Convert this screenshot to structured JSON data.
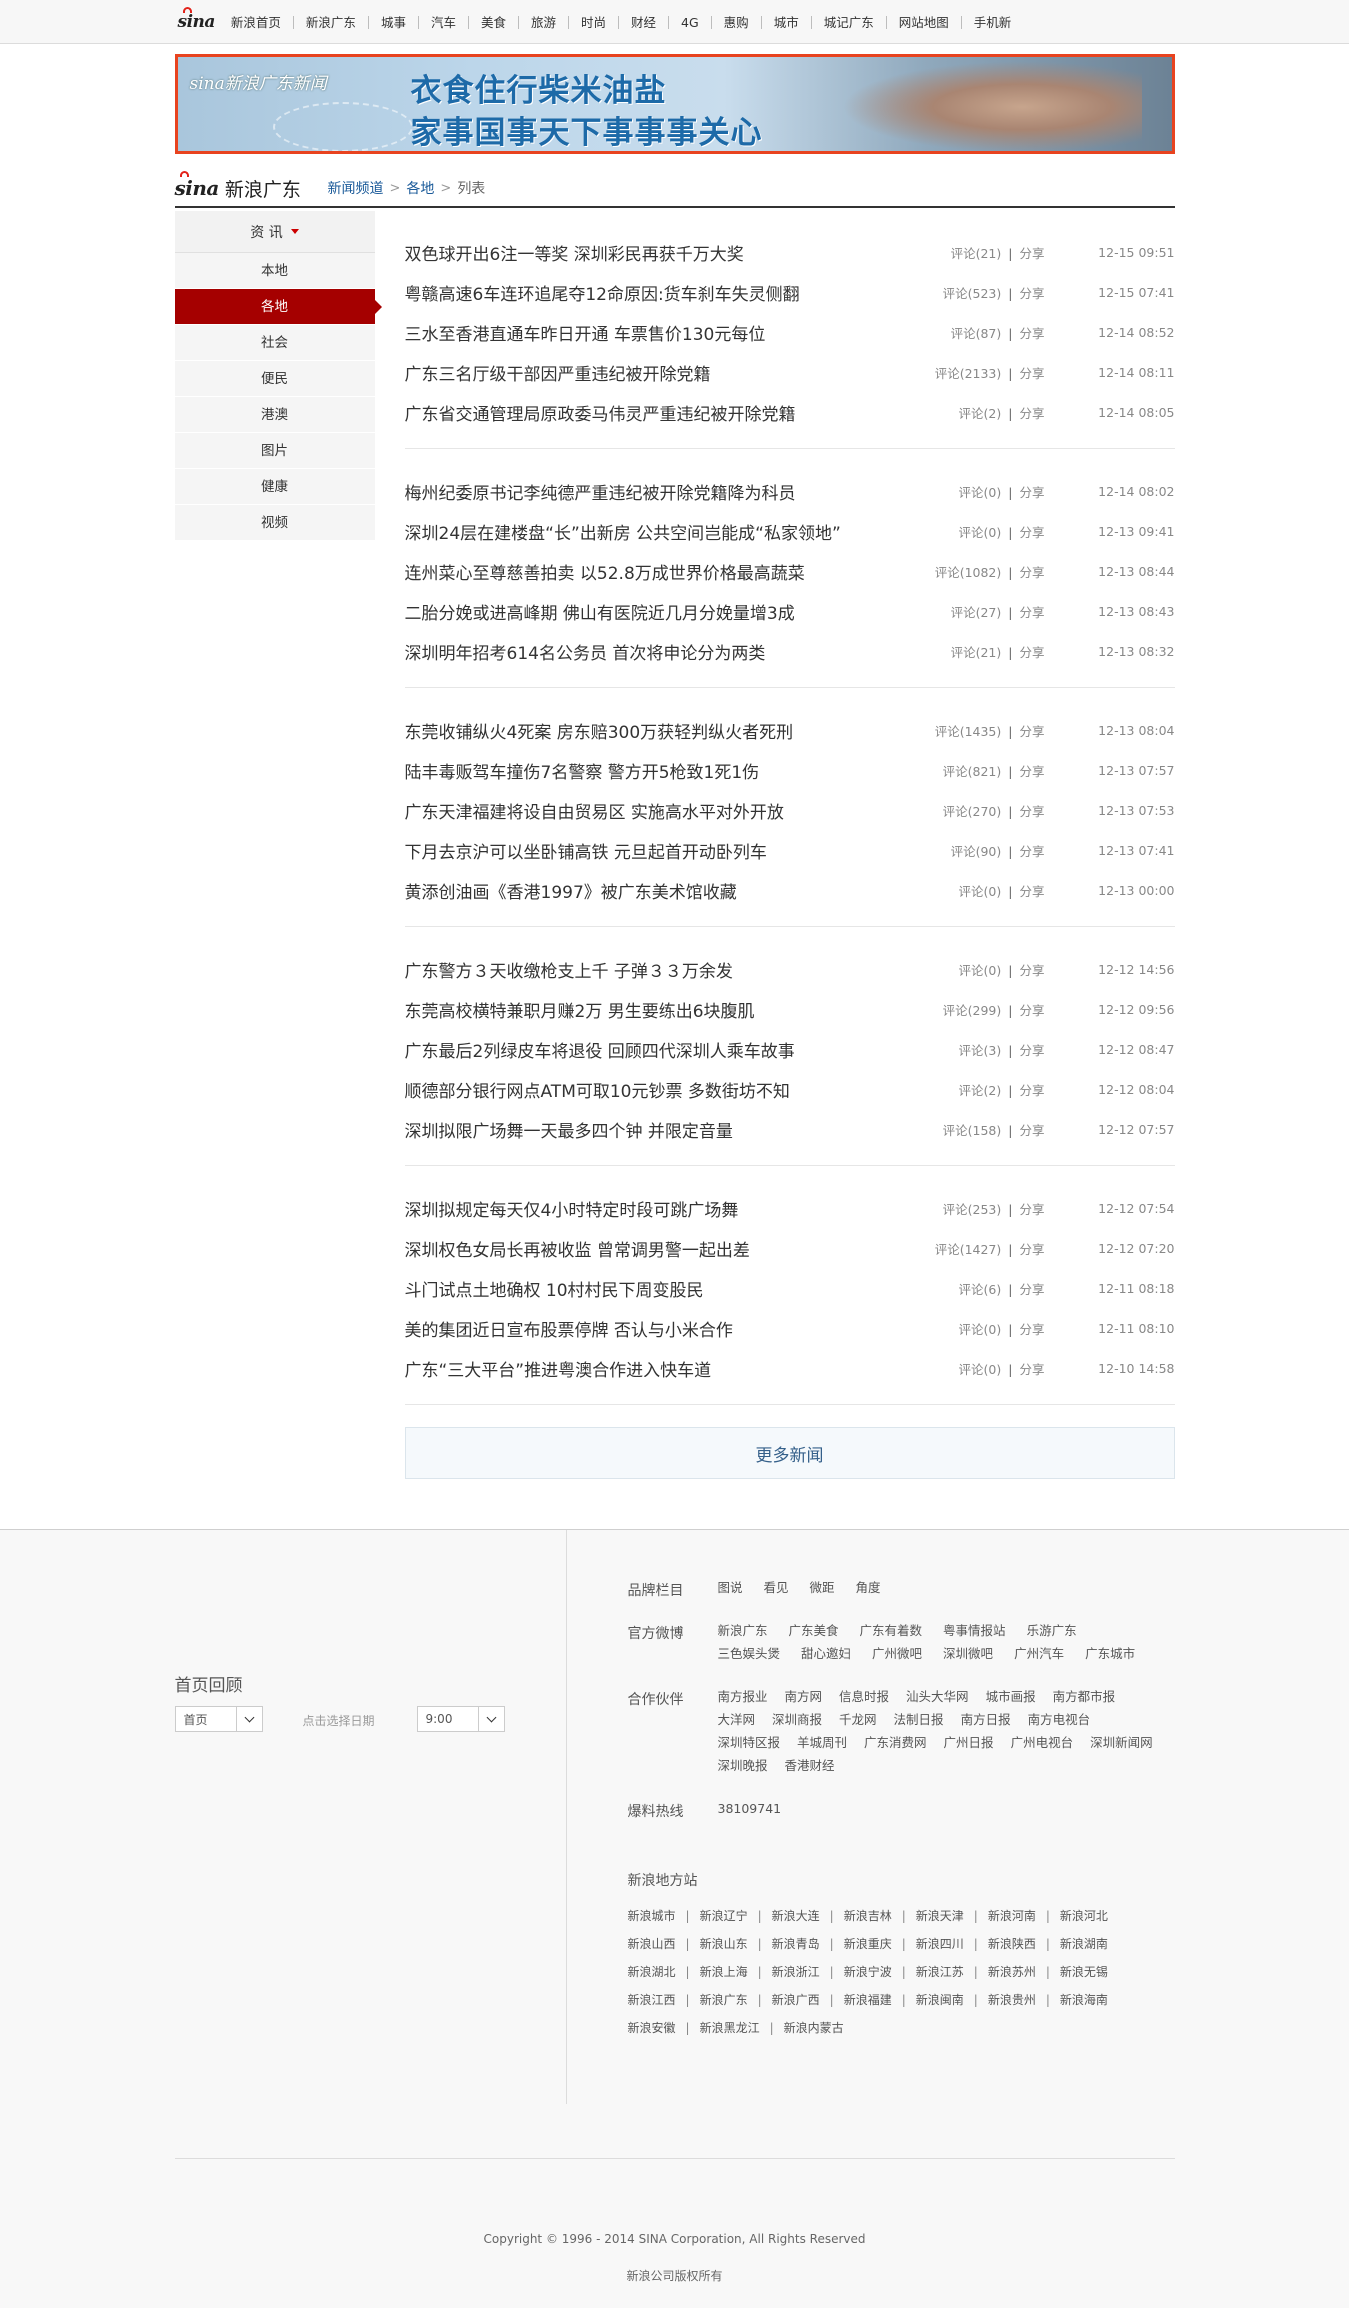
{
  "topnav": {
    "logo": "sina",
    "items": [
      "新浪首页",
      "新浪广东",
      "城事",
      "汽车",
      "美食",
      "旅游",
      "时尚",
      "财经",
      "4G",
      "惠购",
      "城市",
      "城记广东",
      "网站地图",
      "手机新"
    ]
  },
  "banner": {
    "brand": "sina新浪广东新闻",
    "line1": "衣食住行柴米油盐",
    "line2": "家事国事天下事事事关心"
  },
  "header": {
    "logo_text": "新浪广东",
    "breadcrumb": [
      "新闻频道",
      "各地",
      "列表"
    ],
    "breadcrumb_sep": ">"
  },
  "sidebar": {
    "head": "资 讯",
    "items": [
      "本地",
      "各地",
      "社会",
      "便民",
      "港澳",
      "图片",
      "健康",
      "视频"
    ],
    "active_index": 1
  },
  "news": {
    "groups": [
      [
        {
          "title": "双色球开出6注一等奖 深圳彩民再获千万大奖",
          "comments": "评论(21)",
          "share": "分享",
          "time": "12-15 09:51"
        },
        {
          "title": "粤赣高速6车连环追尾夺12命原因:货车刹车失灵侧翻",
          "comments": "评论(523)",
          "share": "分享",
          "time": "12-15 07:41"
        },
        {
          "title": "三水至香港直通车昨日开通 车票售价130元每位",
          "comments": "评论(87)",
          "share": "分享",
          "time": "12-14 08:52"
        },
        {
          "title": "广东三名厅级干部因严重违纪被开除党籍",
          "comments": "评论(2133)",
          "share": "分享",
          "time": "12-14 08:11"
        },
        {
          "title": "广东省交通管理局原政委马伟灵严重违纪被开除党籍",
          "comments": "评论(2)",
          "share": "分享",
          "time": "12-14 08:05"
        }
      ],
      [
        {
          "title": "梅州纪委原书记李纯德严重违纪被开除党籍降为科员",
          "comments": "评论(0)",
          "share": "分享",
          "time": "12-14 08:02"
        },
        {
          "title": "深圳24层在建楼盘“长”出新房 公共空间岂能成“私家领地”",
          "comments": "评论(0)",
          "share": "分享",
          "time": "12-13 09:41"
        },
        {
          "title": "连州菜心至尊慈善拍卖 以52.8万成世界价格最高蔬菜",
          "comments": "评论(1082)",
          "share": "分享",
          "time": "12-13 08:44"
        },
        {
          "title": "二胎分娩或进高峰期 佛山有医院近几月分娩量增3成",
          "comments": "评论(27)",
          "share": "分享",
          "time": "12-13 08:43"
        },
        {
          "title": "深圳明年招考614名公务员 首次将申论分为两类",
          "comments": "评论(21)",
          "share": "分享",
          "time": "12-13 08:32"
        }
      ],
      [
        {
          "title": "东莞收铺纵火4死案 房东赔300万获轻判纵火者死刑",
          "comments": "评论(1435)",
          "share": "分享",
          "time": "12-13 08:04"
        },
        {
          "title": "陆丰毒贩驾车撞伤7名警察 警方开5枪致1死1伤",
          "comments": "评论(821)",
          "share": "分享",
          "time": "12-13 07:57"
        },
        {
          "title": "广东天津福建将设自由贸易区 实施高水平对外开放",
          "comments": "评论(270)",
          "share": "分享",
          "time": "12-13 07:53"
        },
        {
          "title": "下月去京沪可以坐卧铺高铁 元旦起首开动卧列车",
          "comments": "评论(90)",
          "share": "分享",
          "time": "12-13 07:41"
        },
        {
          "title": "黄添创油画《香港1997》被广东美术馆收藏",
          "comments": "评论(0)",
          "share": "分享",
          "time": "12-13 00:00"
        }
      ],
      [
        {
          "title": "广东警方３天收缴枪支上千 子弹３３万余发",
          "comments": "评论(0)",
          "share": "分享",
          "time": "12-12 14:56"
        },
        {
          "title": "东莞高校横特兼职月赚2万 男生要练出6块腹肌",
          "comments": "评论(299)",
          "share": "分享",
          "time": "12-12 09:56"
        },
        {
          "title": "广东最后2列绿皮车将退役 回顾四代深圳人乘车故事",
          "comments": "评论(3)",
          "share": "分享",
          "time": "12-12 08:47"
        },
        {
          "title": "顺德部分银行网点ATM可取10元钞票 多数街坊不知",
          "comments": "评论(2)",
          "share": "分享",
          "time": "12-12 08:04"
        },
        {
          "title": "深圳拟限广场舞一天最多四个钟 并限定音量",
          "comments": "评论(158)",
          "share": "分享",
          "time": "12-12 07:57"
        }
      ],
      [
        {
          "title": "深圳拟规定每天仅4小时特定时段可跳广场舞",
          "comments": "评论(253)",
          "share": "分享",
          "time": "12-12 07:54"
        },
        {
          "title": "深圳权色女局长再被收监 曾常调男警一起出差",
          "comments": "评论(1427)",
          "share": "分享",
          "time": "12-12 07:20"
        },
        {
          "title": "斗门试点土地确权 10村村民下周变股民",
          "comments": "评论(6)",
          "share": "分享",
          "time": "12-11 08:18"
        },
        {
          "title": "美的集团近日宣布股票停牌 否认与小米合作",
          "comments": "评论(0)",
          "share": "分享",
          "time": "12-11 08:10"
        },
        {
          "title": "广东“三大平台”推进粤澳合作进入快车道",
          "comments": "评论(0)",
          "share": "分享",
          "time": "12-10 14:58"
        }
      ]
    ],
    "more_label": "更多新闻"
  },
  "footer": {
    "review": {
      "title": "首页回顾",
      "select1": "首页",
      "hint": "点击选择日期",
      "select2": "9:00"
    },
    "brand_col": {
      "label": "品牌栏目",
      "links": [
        "图说",
        "看见",
        "微距",
        "角度"
      ]
    },
    "weibo": {
      "label": "官方微博",
      "links": [
        "新浪广东",
        "广东美食",
        "广东有着数",
        "粤事情报站",
        "乐游广东",
        "三色娱头煲",
        "甜心邀妇",
        "广州微吧",
        "深圳微吧",
        "广州汽车",
        "广东城市"
      ]
    },
    "partners": {
      "label": "合作伙伴",
      "links": [
        "南方报业",
        "南方网",
        "信息时报",
        "汕头大华网",
        "城市画报",
        "南方都市报",
        "大洋网",
        "深圳商报",
        "千龙网",
        "法制日报",
        "南方日报",
        "南方电视台",
        "深圳特区报",
        "羊城周刊",
        "广东消费网",
        "广州日报",
        "广州电视台",
        "深圳新闻网",
        "深圳晚报",
        "香港财经"
      ]
    },
    "hotline": {
      "label": "爆料热线",
      "value": "38109741"
    },
    "local": {
      "title": "新浪地方站",
      "links": [
        "新浪城市",
        "新浪辽宁",
        "新浪大连",
        "新浪吉林",
        "新浪天津",
        "新浪河南",
        "新浪河北",
        "新浪山西",
        "新浪山东",
        "新浪青岛",
        "新浪重庆",
        "新浪四川",
        "新浪陕西",
        "新浪湖南",
        "新浪湖北",
        "新浪上海",
        "新浪浙江",
        "新浪宁波",
        "新浪江苏",
        "新浪苏州",
        "新浪无锡",
        "新浪江西",
        "新浪广东",
        "新浪广西",
        "新浪福建",
        "新浪闽南",
        "新浪贵州",
        "新浪海南",
        "新浪安徽",
        "新浪黑龙江",
        "新浪内蒙古"
      ],
      "sep": "|"
    },
    "copyright": "Copyright © 1996 - 2014 SINA Corporation, All Rights Reserved",
    "rights": "新浪公司版权所有"
  }
}
